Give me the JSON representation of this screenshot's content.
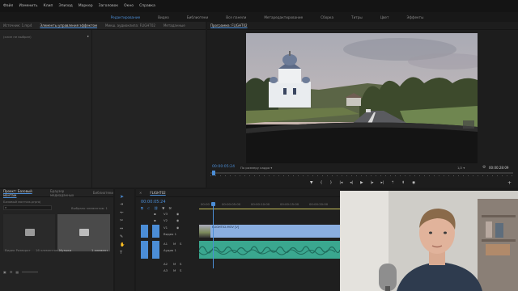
{
  "menu": [
    "Файл",
    "Изменить",
    "Клип",
    "Эпизод",
    "Маркер",
    "Заголовок",
    "Окно",
    "Справка"
  ],
  "workspaces": [
    {
      "label": "Редактирование",
      "active": true
    },
    {
      "label": "Видео"
    },
    {
      "label": "Библиотеки"
    },
    {
      "label": "Все панели"
    },
    {
      "label": "Метаредактирование"
    },
    {
      "label": "Сборка"
    },
    {
      "label": "Титры"
    },
    {
      "label": "Цвет"
    },
    {
      "label": "Эффекты"
    }
  ],
  "source_panel": {
    "tabs": [
      "Источник: 1.mp4",
      "Элементы управления эффектом",
      "Микш. аудиоклипа: FLIGHT02",
      "Метаданные"
    ],
    "selected_tab": 1,
    "no_clip_text": "(клип не выбран)"
  },
  "program": {
    "title": "Программа: FLIGHT02",
    "timecode": "00:00:05:24",
    "fit_label": "По размеру кадра",
    "quality": "1/2",
    "duration": "00:00:28:09"
  },
  "project": {
    "tabs": [
      "Проект: Базовый монтаж",
      "Браузер медиаданных",
      "Библиотеки"
    ],
    "path": "Базовый монтаж.prproj",
    "search_hint": "",
    "selected_info": "Выбрано элементов: 1",
    "bins": [
      {
        "name": "Видео Разворот",
        "count": "16 элементов"
      },
      {
        "name": "Музыка",
        "count": "1 элемент"
      }
    ]
  },
  "timeline": {
    "sequence_tab": "FLIGHT02",
    "timecode": "00:00:05:24",
    "ruler": [
      "00:00",
      "00:00:05:00",
      "00:00:10:00",
      "00:00:15:00",
      "00:00:20:00",
      "00:00:25:00"
    ],
    "video_tracks": [
      "V3",
      "V2",
      "V1"
    ],
    "audio_tracks": [
      "A1",
      "A2",
      "A3"
    ],
    "video1_label": "Видео 1",
    "audio1_label": "Аудио 1",
    "clip_label": "FLIGHT02.MOV [V]"
  },
  "colors": {
    "accent": "#4b8dd6",
    "video_clip": "#8aaee0",
    "audio_clip": "#3aa78f",
    "playhead": "#4b8dd6"
  }
}
